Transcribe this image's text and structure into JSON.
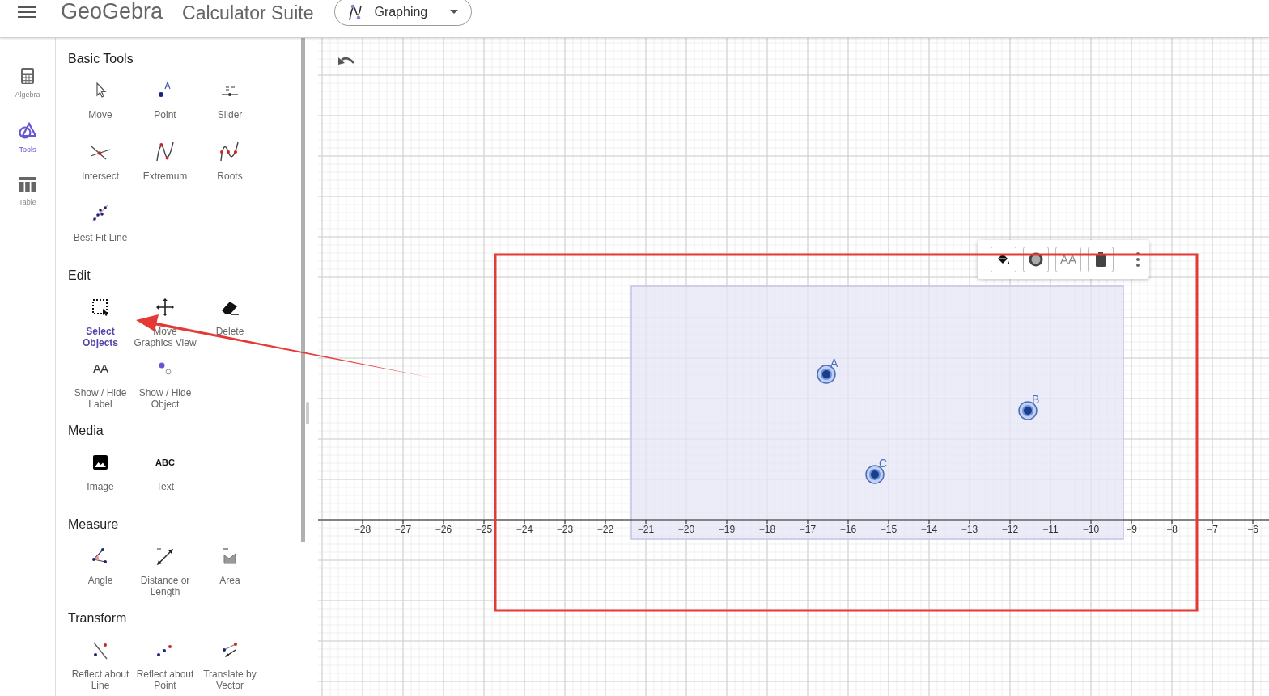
{
  "header": {
    "logo": "GeoGebra",
    "suite": "Calculator Suite",
    "app_picker": {
      "label": "Graphing"
    }
  },
  "rail": [
    {
      "label": "Algebra",
      "kind": "calculator",
      "selected": false
    },
    {
      "label": "Tools",
      "kind": "shapes",
      "selected": true
    },
    {
      "label": "Table",
      "kind": "table",
      "selected": false
    }
  ],
  "tool_sections": [
    {
      "title": "Basic Tools",
      "tools": [
        {
          "label": "Move",
          "kind": "move",
          "selected": false
        },
        {
          "label": "Point",
          "kind": "point",
          "selected": false
        },
        {
          "label": "Slider",
          "kind": "slider",
          "selected": false
        },
        {
          "label": "Intersect",
          "kind": "intersect",
          "selected": false
        },
        {
          "label": "Extremum",
          "kind": "extremum",
          "selected": false
        },
        {
          "label": "Roots",
          "kind": "roots",
          "selected": false
        },
        {
          "label": "Best Fit Line",
          "kind": "fitline",
          "selected": false
        }
      ]
    },
    {
      "title": "Edit",
      "tools": [
        {
          "label": "Select Objects",
          "kind": "select",
          "selected": true
        },
        {
          "label": "Move Graphics View",
          "kind": "pan",
          "selected": false
        },
        {
          "label": "Delete",
          "kind": "delete",
          "selected": false
        },
        {
          "label": "Show / Hide Label",
          "kind": "label",
          "icon_text": "AA",
          "selected": false
        },
        {
          "label": "Show / Hide Object",
          "kind": "visibility",
          "selected": false
        }
      ]
    },
    {
      "title": "Media",
      "tools": [
        {
          "label": "Image",
          "kind": "image",
          "selected": false
        },
        {
          "label": "Text",
          "kind": "text",
          "icon_text": "ABC",
          "selected": false
        }
      ]
    },
    {
      "title": "Measure",
      "tools": [
        {
          "label": "Angle",
          "kind": "angle",
          "selected": false
        },
        {
          "label": "Distance or Length",
          "kind": "distance",
          "selected": false
        },
        {
          "label": "Area",
          "kind": "area",
          "selected": false
        }
      ]
    },
    {
      "title": "Transform",
      "tools": [
        {
          "label": "Reflect about Line",
          "kind": "reflectline",
          "selected": false
        },
        {
          "label": "Reflect about Point",
          "kind": "reflectpoint",
          "selected": false
        },
        {
          "label": "Translate by Vector",
          "kind": "translate",
          "selected": false
        }
      ]
    }
  ],
  "graphics": {
    "x_tick_labels": [
      "−28",
      "−27",
      "−26",
      "−25",
      "−24",
      "−23",
      "−22",
      "−21",
      "−20",
      "−19",
      "−18",
      "−17",
      "−16",
      "−15",
      "−14",
      "−13",
      "−12",
      "−11",
      "−10",
      "−9",
      "−8",
      "−7",
      "−6"
    ],
    "points": [
      {
        "label": "A",
        "selected": true
      },
      {
        "label": "B",
        "selected": true
      },
      {
        "label": "C",
        "selected": true
      }
    ],
    "style_bar": [
      {
        "kind": "fill"
      },
      {
        "kind": "pointstyle"
      },
      {
        "kind": "label",
        "icon_text": "AA"
      },
      {
        "kind": "delete"
      },
      {
        "kind": "more"
      }
    ]
  }
}
